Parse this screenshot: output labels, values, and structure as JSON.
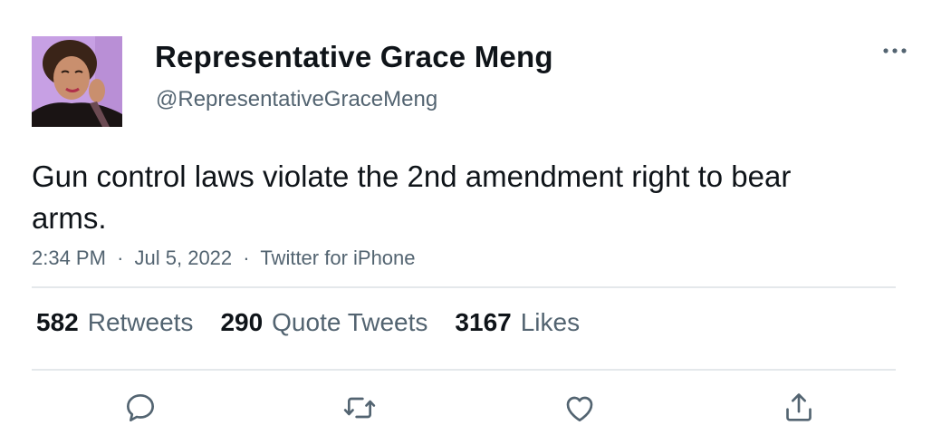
{
  "author": {
    "display_name": "Representative Grace Meng",
    "handle": "@RepresentativeGraceMeng",
    "avatar_icon": "profile-photo"
  },
  "tweet": {
    "text": "Gun control laws violate the 2nd amendment right to bear arms.",
    "time": "2:34 PM",
    "date": "Jul 5, 2022",
    "source": "Twitter for iPhone",
    "separator": "·"
  },
  "stats": [
    {
      "count": "582",
      "label": "Retweets"
    },
    {
      "count": "290",
      "label": "Quote Tweets"
    },
    {
      "count": "3167",
      "label": "Likes"
    }
  ],
  "actions": [
    {
      "icon": "reply-icon"
    },
    {
      "icon": "retweet-icon"
    },
    {
      "icon": "like-icon"
    },
    {
      "icon": "share-icon"
    }
  ],
  "more_icon": "more-dots-icon",
  "colors": {
    "text_primary": "#0f1419",
    "text_secondary": "#536471",
    "divider": "#e4e8eb",
    "icon": "#536471"
  }
}
